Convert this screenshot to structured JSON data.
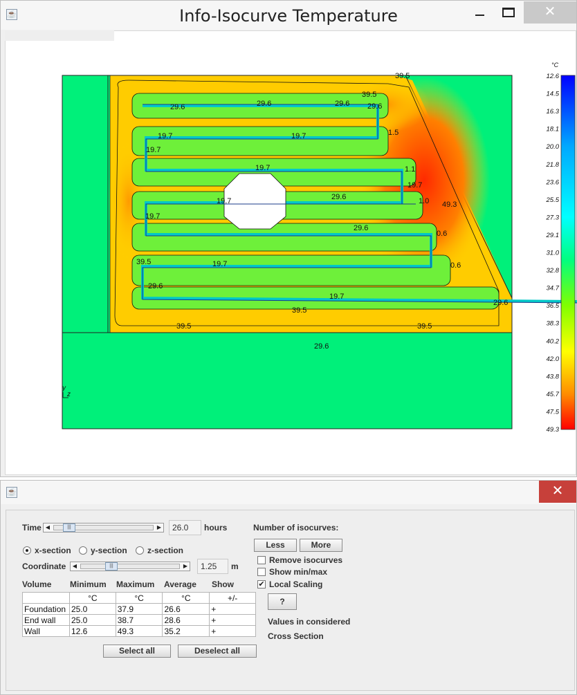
{
  "window1": {
    "title": "Info-Isocurve Temperature",
    "close_glyph": "✕",
    "plot": {
      "axis_y_label": "y",
      "axis_z_label": "z",
      "unit": "°C",
      "color_scale_ticks": [
        "12.6",
        "14.5",
        "16.3",
        "18.1",
        "20.0",
        "21.8",
        "23.6",
        "25.5",
        "27.3",
        "29.1",
        "31.0",
        "32.8",
        "34.7",
        "36.5",
        "38.3",
        "40.2",
        "42.0",
        "43.8",
        "45.7",
        "47.5",
        "49.3"
      ],
      "iso_labels": {
        "top_right": "39.5",
        "upper": "39.5",
        "row1": "29.6",
        "row1b": "29.6",
        "row1c": "29.6",
        "row1d": "29.6",
        "row2": "19.7",
        "row2b": "19.7",
        "right1": "1.5",
        "row3": "19.7",
        "row3b": "19.7",
        "right2": "1.1",
        "right3": "19.7",
        "row4": "19.7",
        "row4b": "29.6",
        "right4": "1.0",
        "hot": "49.3",
        "row5": "19.7",
        "row5b": "29.6",
        "right5": "0.6",
        "row6": "39.5",
        "row6b": "29.6",
        "row6c": "19.7",
        "right6": "0.6",
        "row7": "19.7",
        "mid_bottom": "39.5",
        "bottom_left": "39.5",
        "bottom_right": "39.5",
        "foundation": "29.6",
        "pipe_end": "29.6"
      }
    }
  },
  "window2": {
    "close_glyph": "✕",
    "time_label": "Time",
    "time_value": "26.0",
    "time_unit": "hours",
    "sections": [
      "x-section",
      "y-section",
      "z-section"
    ],
    "selected_section": "x-section",
    "coordinate_label": "Coordinate",
    "coordinate_value": "1.25",
    "coordinate_unit": "m",
    "table_headers": [
      "Volume",
      "Minimum",
      "Maximum",
      "Average",
      "Show"
    ],
    "table_units": [
      "",
      "°C",
      "°C",
      "°C",
      "+/-"
    ],
    "rows": [
      {
        "volume": "Foundation",
        "min": "25.0",
        "max": "37.9",
        "avg": "26.6",
        "show": "+"
      },
      {
        "volume": "End wall",
        "min": "25.0",
        "max": "38.7",
        "avg": "28.6",
        "show": "+"
      },
      {
        "volume": "Wall",
        "min": "12.6",
        "max": "49.3",
        "avg": "35.2",
        "show": "+"
      }
    ],
    "select_all": "Select all",
    "deselect_all": "Deselect all",
    "isocurves_title": "Number of isocurves:",
    "less": "Less",
    "more": "More",
    "remove_isocurves": "Remove isocurves",
    "show_minmax": "Show min/max",
    "local_scaling": "Local Scaling",
    "local_scaling_checked": true,
    "help": "?",
    "values_line1": "Values in considered",
    "values_line2": "Cross Section"
  }
}
